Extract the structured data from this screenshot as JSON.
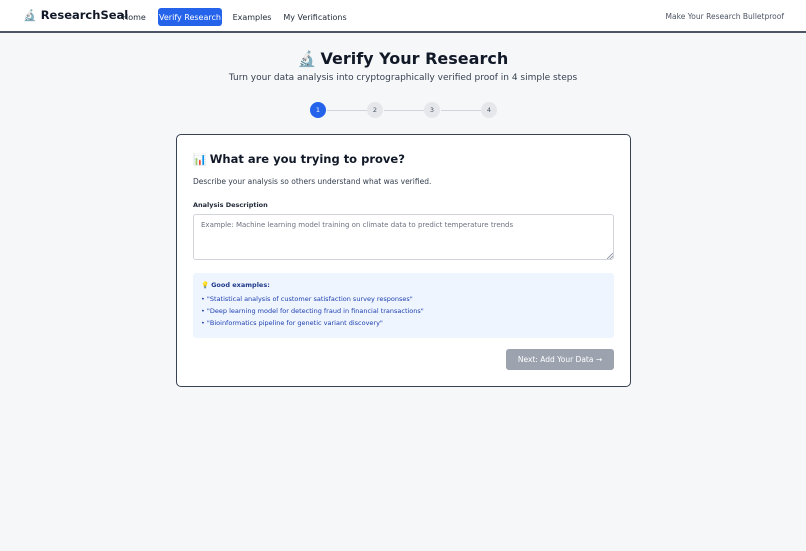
{
  "navbar": {
    "brand_icon": "🔬",
    "brand_name": "ResearchSeal",
    "links": [
      {
        "label": "Home"
      },
      {
        "label": "Verify Research",
        "active": true
      },
      {
        "label": "Examples"
      },
      {
        "label": "My Verifications"
      }
    ],
    "tagline": "Make Your Research Bulletproof"
  },
  "header": {
    "title_icon": "🔬",
    "title": "Verify Your Research",
    "subtitle": "Turn your data analysis into cryptographically verified proof in 4 simple steps"
  },
  "stepper": {
    "current_step": 1,
    "steps": [
      "1",
      "2",
      "3",
      "4"
    ]
  },
  "form": {
    "title_icon": "📊",
    "title": "What are you trying to prove?",
    "description": "Describe your analysis so others understand what was verified.",
    "field_label": "Analysis Description",
    "field_value": "",
    "field_placeholder": "Example: Machine learning model training on climate data to predict temperature trends",
    "examples_icon": "💡",
    "examples_title": "Good examples:",
    "examples": [
      "• \"Statistical analysis of customer satisfaction survey responses\"",
      "• \"Deep learning model for detecting fraud in financial transactions\"",
      "• \"Bioinformatics pipeline for genetic variant discovery\""
    ],
    "next_label": "Next: Add Your Data →"
  },
  "colors": {
    "accent": "#2563eb",
    "disabled_button": "#9ca3af",
    "examples_bg": "#eff5ff"
  }
}
